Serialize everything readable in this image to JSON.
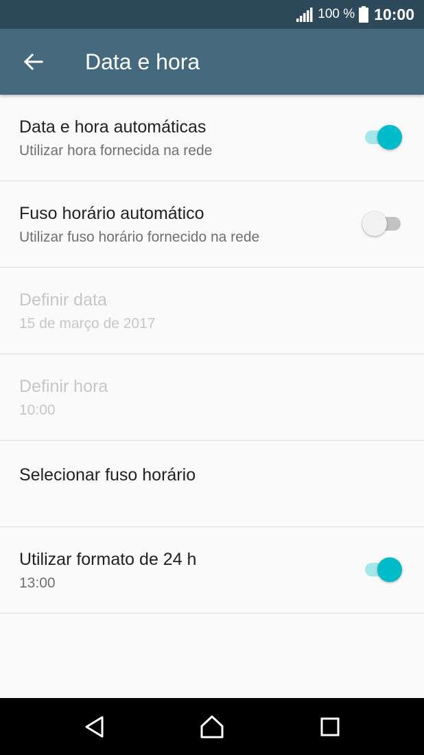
{
  "status_bar": {
    "battery_percent": "100 %",
    "time": "10:00",
    "icons": [
      "signal-icon",
      "battery-icon"
    ]
  },
  "app_bar": {
    "title": "Data e hora",
    "back_icon": "arrow-left-icon"
  },
  "settings": [
    {
      "title": "Data e hora automáticas",
      "subtitle": "Utilizar hora fornecida na rede",
      "enabled": true,
      "switch": "on"
    },
    {
      "title": "Fuso horário automático",
      "subtitle": "Utilizar fuso horário fornecido na rede",
      "enabled": true,
      "switch": "off"
    },
    {
      "title": "Definir data",
      "subtitle": "15 de março de 2017",
      "enabled": false
    },
    {
      "title": "Definir hora",
      "subtitle": "10:00",
      "enabled": false
    },
    {
      "title": "Selecionar fuso horário",
      "subtitle": "",
      "enabled": true
    },
    {
      "title": "Utilizar formato de 24 h",
      "subtitle": "13:00",
      "enabled": true,
      "switch": "on"
    }
  ],
  "nav_bar": {
    "buttons": [
      "back-triangle-icon",
      "home-icon",
      "recents-square-icon"
    ]
  },
  "colors": {
    "status_bar": "#2e4a5a",
    "app_bar": "#456a7e",
    "accent": "#00bcc8",
    "accent_track": "#a4e7ea",
    "background": "#fafafa",
    "disabled_text": "#c6c6c6"
  }
}
